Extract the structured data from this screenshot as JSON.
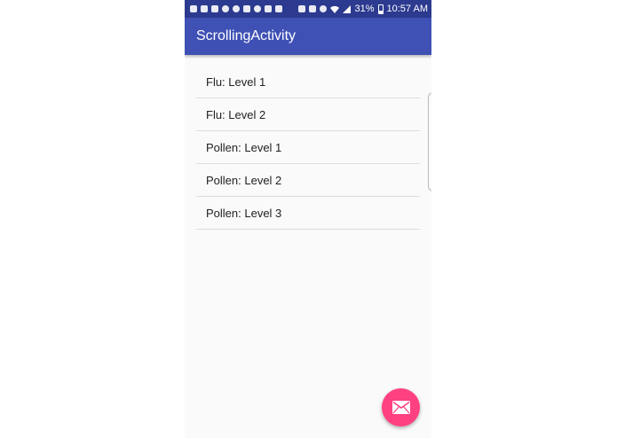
{
  "status_bar": {
    "battery": "31%",
    "time": "10:57 AM",
    "icons": [
      "messages-icon",
      "missed-call-icon",
      "calendar-icon",
      "snapchat-icon",
      "circle-icon",
      "gallery-icon",
      "smiley-icon",
      "twitter-icon",
      "voicemail-icon",
      "nfc-icon",
      "mute-icon",
      "alarm-icon",
      "wifi-icon",
      "signal-icon",
      "battery-icon"
    ]
  },
  "app_bar": {
    "title": "ScrollingActivity",
    "color": "#3f51b5"
  },
  "list": {
    "items": [
      {
        "label": "Flu: Level 1"
      },
      {
        "label": "Flu: Level 2"
      },
      {
        "label": "Pollen: Level 1"
      },
      {
        "label": "Pollen: Level 2"
      },
      {
        "label": "Pollen: Level 3"
      }
    ]
  },
  "fab": {
    "icon": "email-icon",
    "color": "#ff4081"
  }
}
